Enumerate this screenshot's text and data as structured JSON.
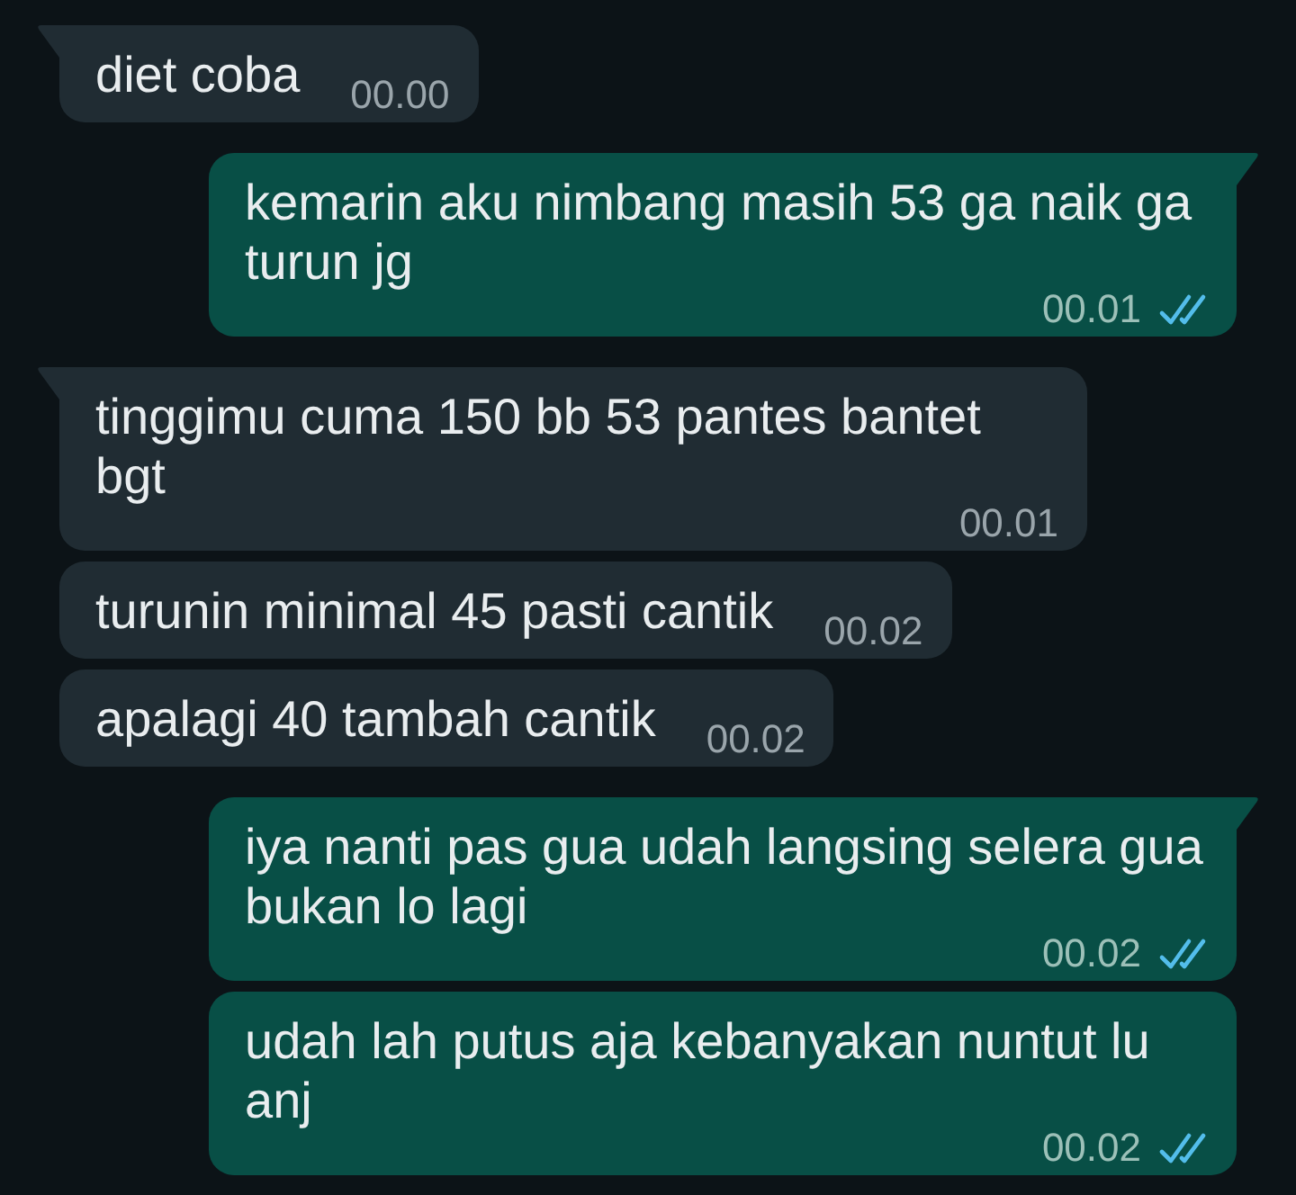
{
  "messages": [
    {
      "kind": "incoming",
      "tail": true,
      "text": "diet coba",
      "time": "00.00"
    },
    {
      "kind": "outgoing",
      "tail": true,
      "text": "kemarin aku nimbang masih 53 ga naik ga turun jg",
      "time": "00.01",
      "read": true
    },
    {
      "kind": "incoming",
      "tail": true,
      "text": "tinggimu cuma 150 bb 53 pantes bantet bgt",
      "time": "00.01"
    },
    {
      "kind": "incoming",
      "tail": false,
      "text": "turunin minimal 45 pasti cantik",
      "time": "00.02"
    },
    {
      "kind": "incoming",
      "tail": false,
      "text": "apalagi 40 tambah cantik",
      "time": "00.02"
    },
    {
      "kind": "outgoing",
      "tail": true,
      "text": "iya nanti pas gua udah langsing selera gua bukan lo lagi",
      "time": "00.02",
      "read": true
    },
    {
      "kind": "outgoing",
      "tail": false,
      "text": "udah lah putus aja kebanyakan nuntut lu anj",
      "time": "00.02",
      "read": true
    }
  ]
}
